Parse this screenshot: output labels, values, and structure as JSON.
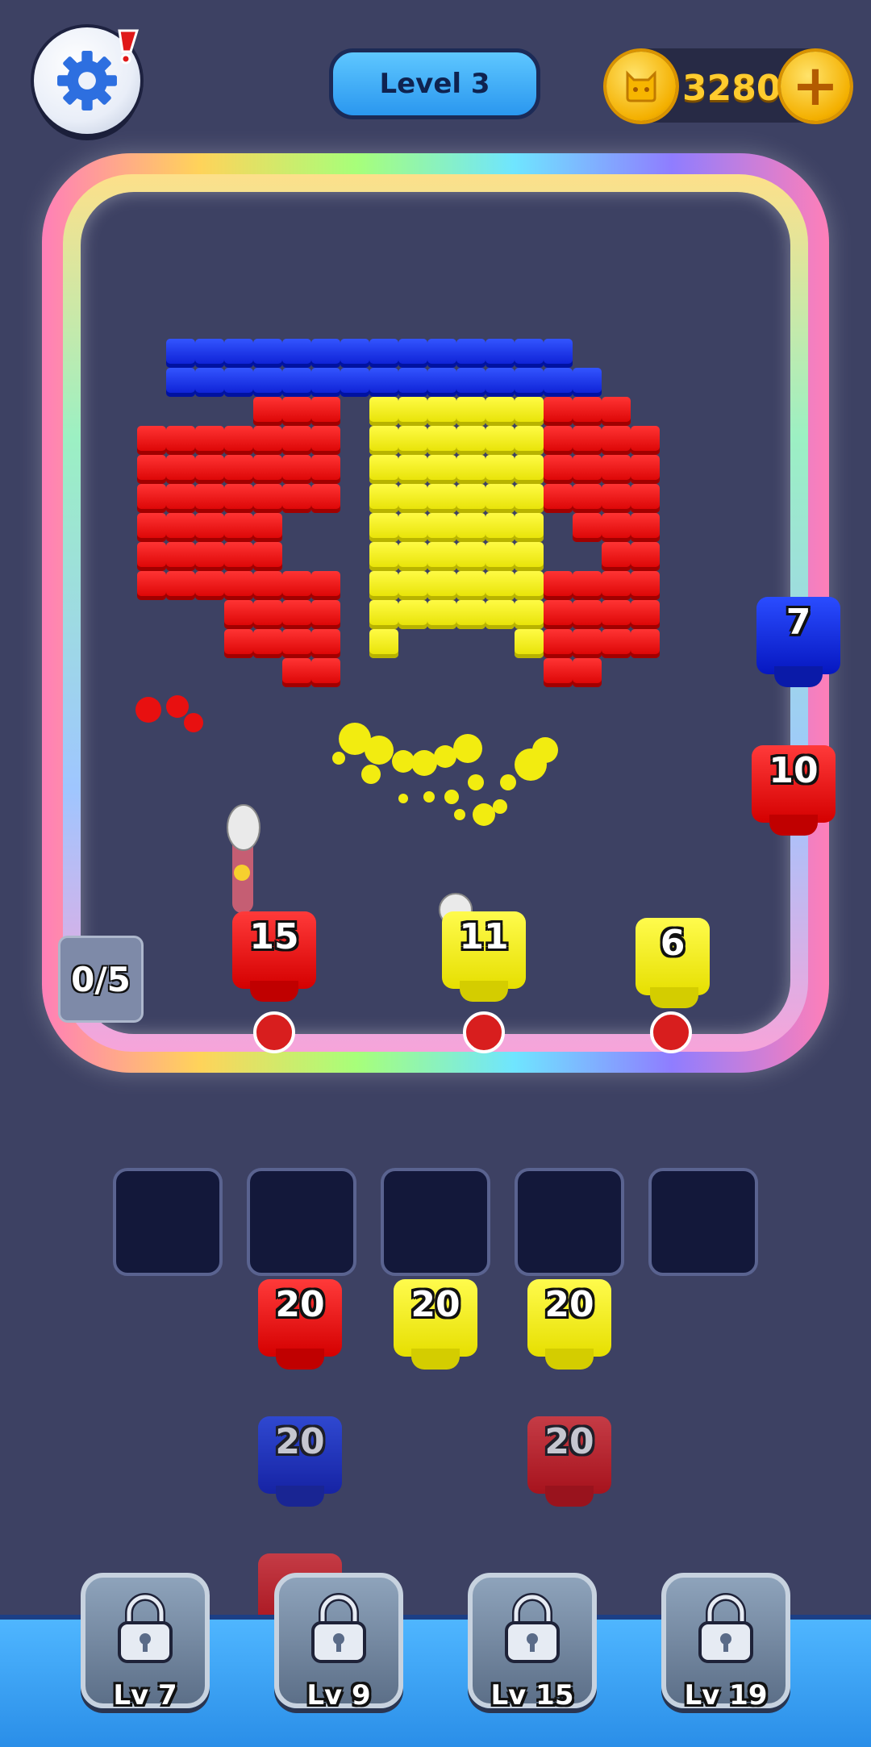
{
  "header": {
    "level_label": "Level 3",
    "coins": "3280",
    "settings_notification": "!"
  },
  "board": {
    "progress_counter": "0/5",
    "colors": {
      "red": "#e81010",
      "yellow": "#f2ec10",
      "blue": "#1530f0"
    }
  },
  "track_shooters": [
    {
      "value": "15",
      "color": "red"
    },
    {
      "value": "11",
      "color": "yellow"
    },
    {
      "value": "6",
      "color": "yellow"
    },
    {
      "value": "7",
      "color": "blue"
    },
    {
      "value": "10",
      "color": "red"
    }
  ],
  "queue": {
    "slot_count": 5,
    "row1": [
      {
        "value": "20",
        "color": "red"
      },
      {
        "value": "20",
        "color": "yellow"
      },
      {
        "value": "20",
        "color": "yellow"
      }
    ],
    "row2": [
      {
        "value": "20",
        "color": "blue"
      },
      {
        "value": "20",
        "color": "red"
      }
    ]
  },
  "locked_boosters": [
    {
      "label": "Lv 7"
    },
    {
      "label": "Lv 9"
    },
    {
      "label": "Lv 15"
    },
    {
      "label": "Lv 19"
    }
  ]
}
